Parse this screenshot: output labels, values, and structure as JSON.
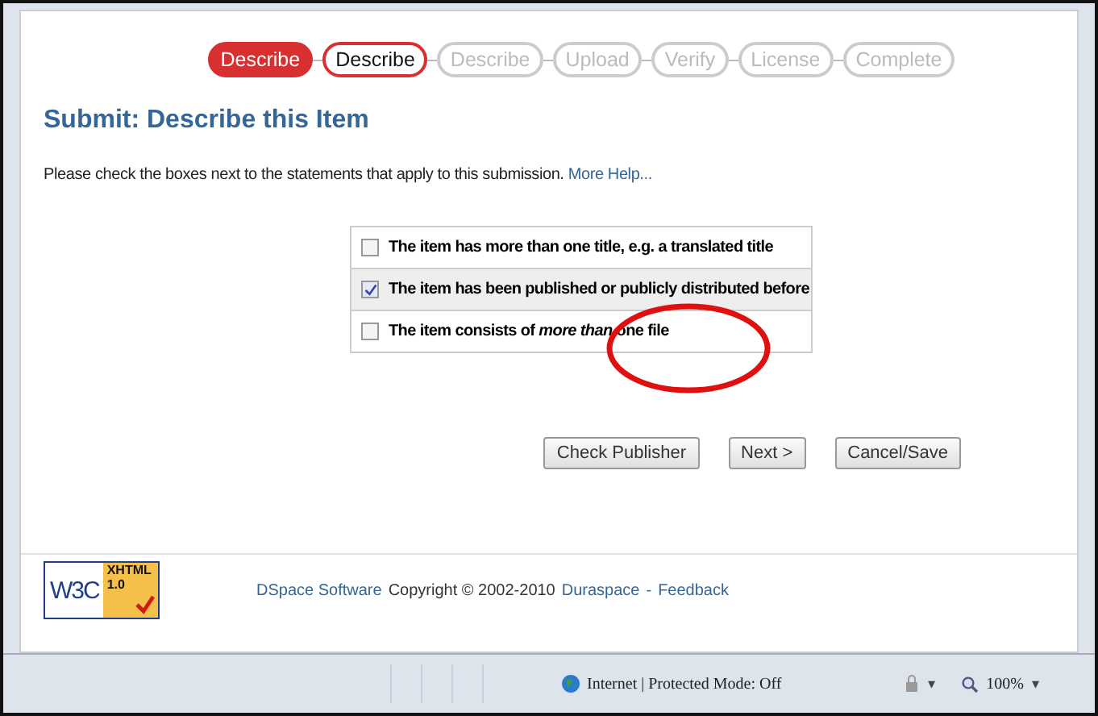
{
  "progress_steps": [
    {
      "label": "Describe",
      "completed": true,
      "selected": false
    },
    {
      "label": "Describe",
      "completed": false,
      "selected": true
    },
    {
      "label": "Describe",
      "completed": false,
      "selected": false
    },
    {
      "label": "Upload",
      "completed": false,
      "selected": false
    },
    {
      "label": "Verify",
      "completed": false,
      "selected": false
    },
    {
      "label": "License",
      "completed": false,
      "selected": false
    },
    {
      "label": "Complete",
      "completed": false,
      "selected": false
    }
  ],
  "page_title": "Submit: Describe this Item",
  "instructions": {
    "text": "Please check the boxes next to the statements that apply to this submission.",
    "link": "More Help..."
  },
  "statements": [
    {
      "text": "The item has more than one title, e.g. a translated title",
      "checked": false
    },
    {
      "text": "The item has been published or publicly distributed before",
      "checked": true
    },
    {
      "text": "The item consists of *more than* one file",
      "checked": false
    }
  ],
  "buttons": [
    "Check Publisher",
    "Next >",
    "Cancel/Save"
  ],
  "footer": {
    "badge": {
      "w3c": "W3C",
      "standard": "XHTML",
      "version": "1.0"
    },
    "brand_link": "DSpace Software",
    "copyright": "Copyright © 2002-2010",
    "links": [
      "Duraspace",
      "Feedback"
    ],
    "separator": "-"
  },
  "status_bar": {
    "zone": "Internet | Protected Mode: Off",
    "zoom": "100%",
    "caret": "▾"
  }
}
